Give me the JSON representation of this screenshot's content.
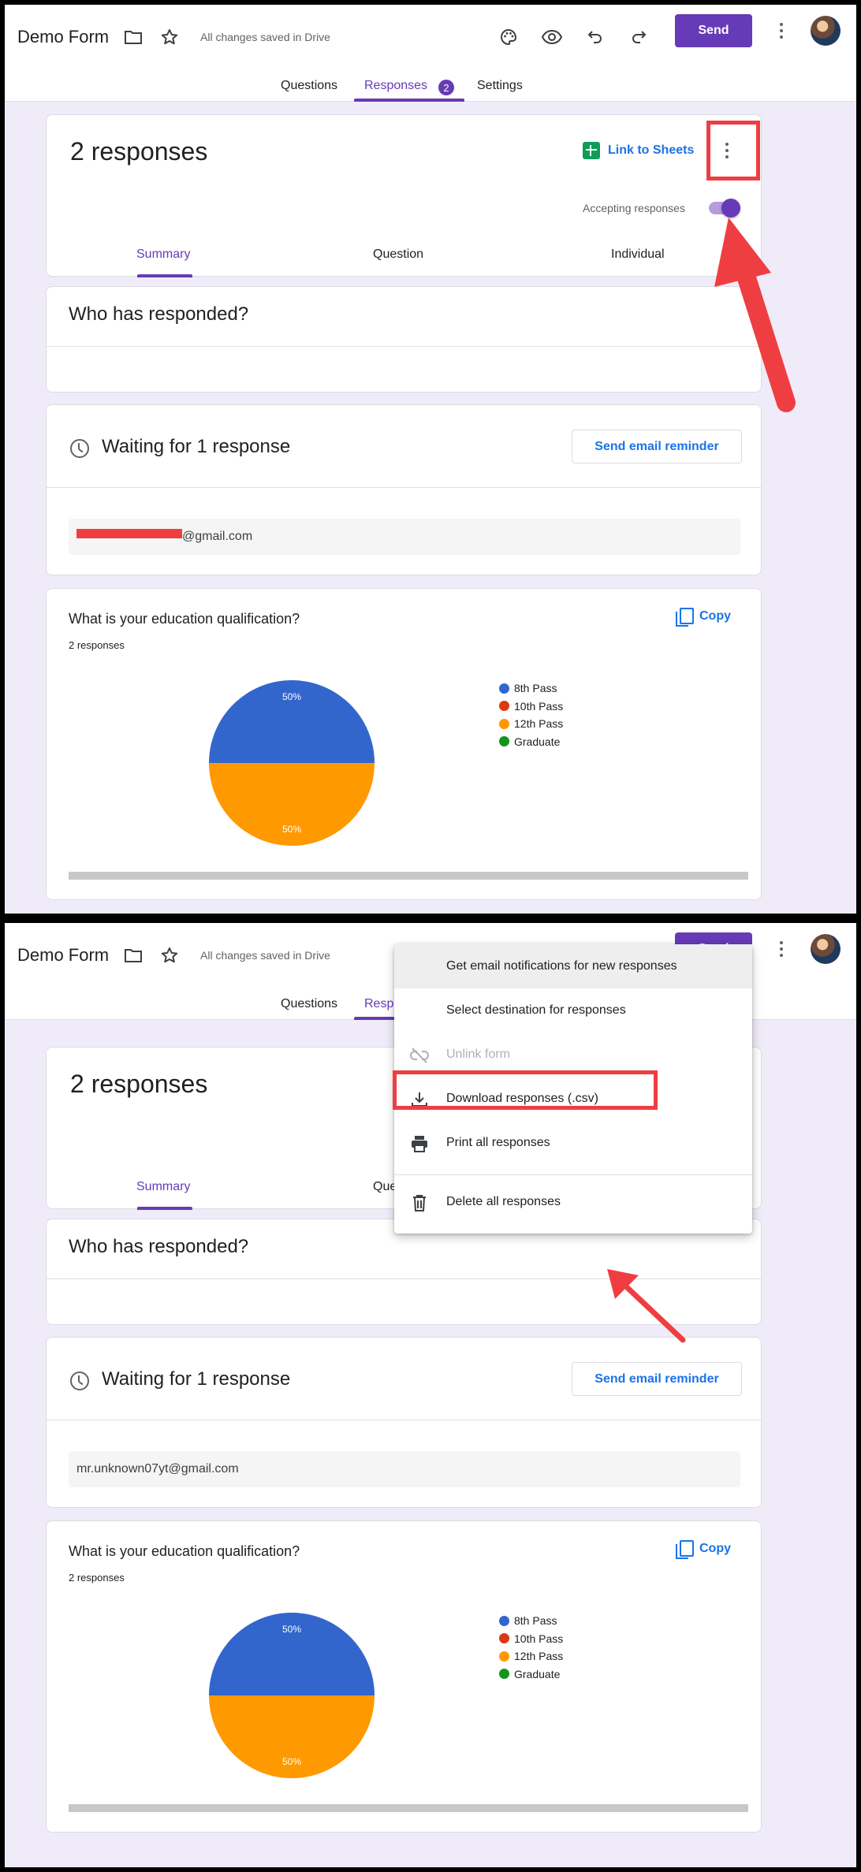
{
  "header": {
    "form_title": "Demo Form",
    "saved_status": "All changes saved in Drive",
    "send_label": "Send",
    "tabs": [
      {
        "label": "Questions"
      },
      {
        "label": "Responses",
        "badge": "2"
      },
      {
        "label": "Settings"
      }
    ]
  },
  "summary_card": {
    "title": "2 responses",
    "link_sheets_label": "Link to Sheets",
    "accepting_label": "Accepting responses",
    "accepting_on": true,
    "subtabs": [
      {
        "label": "Summary"
      },
      {
        "label": "Question"
      },
      {
        "label": "Individual"
      }
    ]
  },
  "who_card": {
    "title": "Who has responded?"
  },
  "waiting_card": {
    "title": "Waiting for 1 response",
    "reminder_label": "Send email reminder",
    "email_redacted": "@gmail.com",
    "email_full": "mr.unknown07yt@gmail.com"
  },
  "question_card": {
    "question": "What is your education qualification?",
    "response_count": "2 responses",
    "copy_label": "Copy",
    "legend": [
      {
        "label": "8th Pass",
        "color": "#3366cc"
      },
      {
        "label": "10th Pass",
        "color": "#dc3912"
      },
      {
        "label": "12th Pass",
        "color": "#ff9900"
      },
      {
        "label": "Graduate",
        "color": "#109618"
      }
    ]
  },
  "chart_data": {
    "type": "pie",
    "title": "What is your education qualification?",
    "categories": [
      "8th Pass",
      "10th Pass",
      "12th Pass",
      "Graduate"
    ],
    "values": [
      50,
      0,
      50,
      0
    ],
    "data_labels": {
      "8th Pass": "50%",
      "12th Pass": "50%"
    }
  },
  "menu": {
    "items": [
      {
        "label": "Get email notifications for new responses",
        "icon": "none",
        "state": "hover"
      },
      {
        "label": "Select destination for responses",
        "icon": "none",
        "state": "normal"
      },
      {
        "label": "Unlink form",
        "icon": "unlink-icon",
        "state": "disabled"
      },
      {
        "label": "Download responses (.csv)",
        "icon": "download-icon",
        "state": "highlighted"
      },
      {
        "label": "Print all responses",
        "icon": "print-icon",
        "state": "normal"
      },
      {
        "label": "Delete all responses",
        "icon": "trash-icon",
        "state": "normal"
      }
    ]
  },
  "annotation_color": "#ef3e42"
}
